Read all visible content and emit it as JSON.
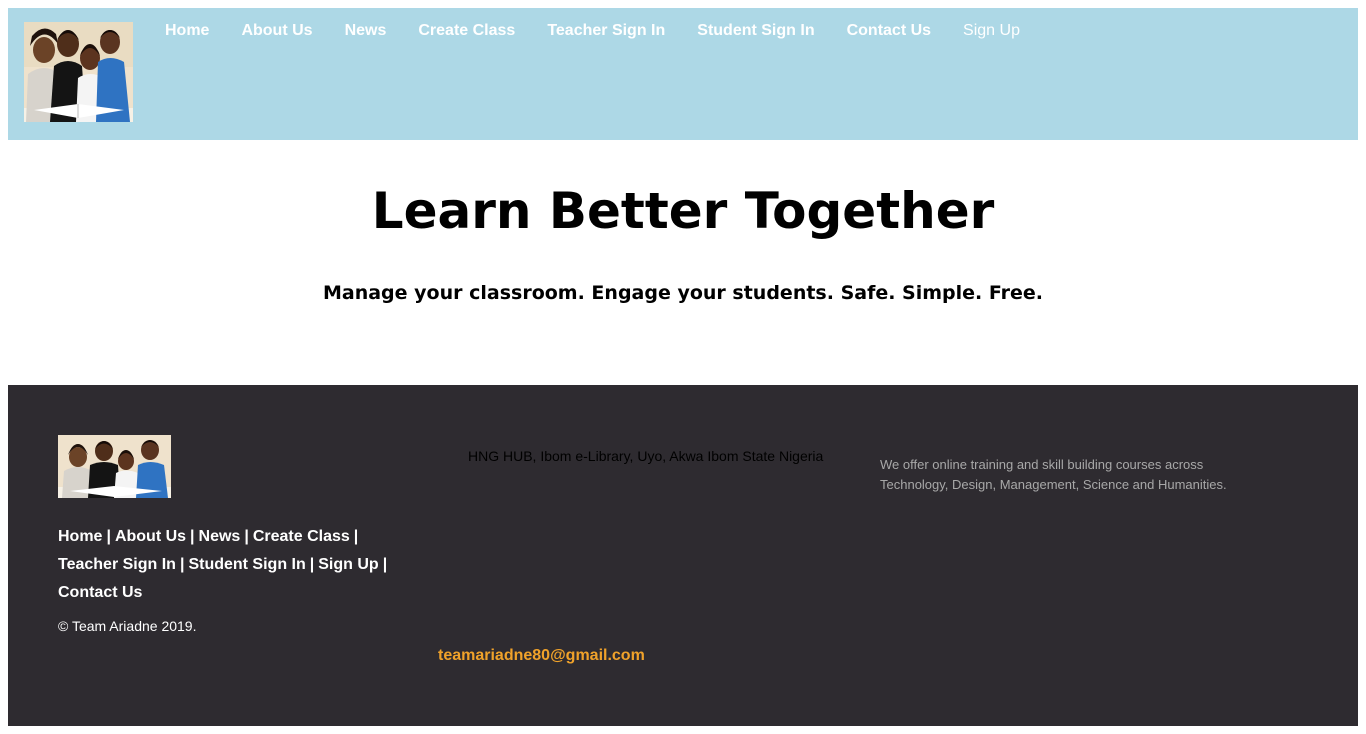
{
  "header": {
    "logo_icon": "students-photo-logo",
    "nav": [
      {
        "label": "Home",
        "bold": true
      },
      {
        "label": "About Us",
        "bold": true
      },
      {
        "label": "News",
        "bold": true
      },
      {
        "label": "Create Class",
        "bold": true
      },
      {
        "label": "Teacher Sign In",
        "bold": true
      },
      {
        "label": "Student Sign In",
        "bold": true
      },
      {
        "label": "Contact Us",
        "bold": true
      },
      {
        "label": "Sign Up",
        "bold": false
      }
    ],
    "background": "#add8e6"
  },
  "hero": {
    "title": "Learn Better Together",
    "subtitle": "Manage your classroom. Engage your students. Safe. Simple. Free."
  },
  "footer": {
    "background": "#2e2b30",
    "links": [
      "Home",
      "About Us",
      "News",
      "Create Class",
      "Teacher Sign In",
      "Student Sign In",
      "Sign Up",
      "Contact Us"
    ],
    "separator": "|",
    "copyright": "© Team Ariadne 2019.",
    "address": "HNG HUB, Ibom e-Library, Uyo, Akwa Ibom State Nigeria",
    "about": "We offer online training and skill building courses across Technology, Design, Management, Science and Humanities.",
    "email": "teamariadne80@gmail.com",
    "email_color": "#f0a22a"
  }
}
